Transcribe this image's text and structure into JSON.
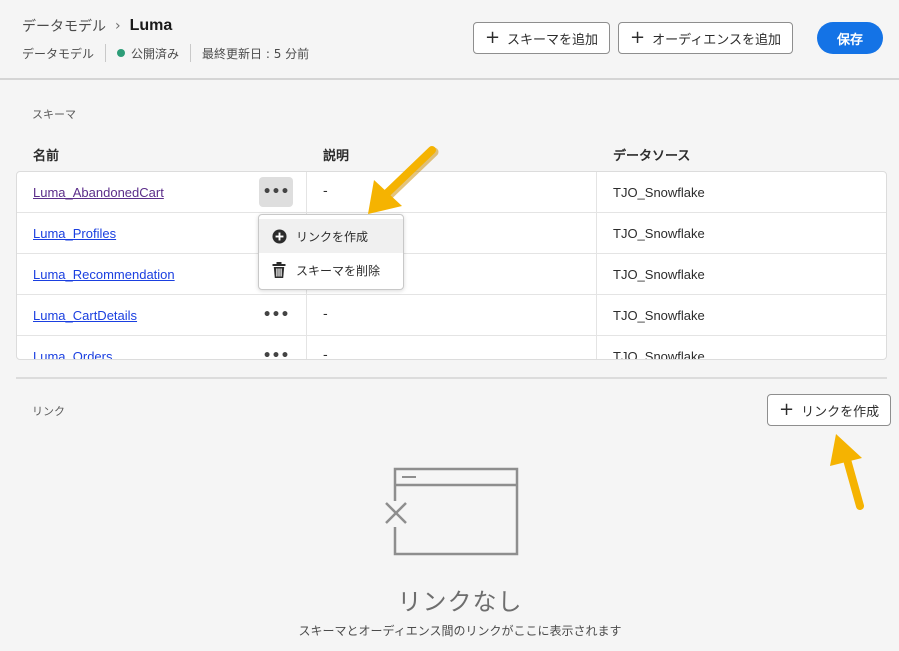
{
  "header": {
    "breadcrumb_parent": "データモデル",
    "breadcrumb_separator": "›",
    "breadcrumb_current": "Luma",
    "meta_type": "データモデル",
    "meta_status": "公開済み",
    "meta_status_color": "#2d9d78",
    "meta_updated": "最終更新日 : 5 分前",
    "add_schema_label": "スキーマを追加",
    "add_audience_label": "オーディエンスを追加",
    "save_label": "保存"
  },
  "schema": {
    "section_label": "スキーマ",
    "columns": [
      "名前",
      "説明",
      "データソース"
    ],
    "rows": [
      {
        "name": "Luma_AbandonedCart",
        "description": "-",
        "source": "TJO_Snowflake"
      },
      {
        "name": "Luma_Profiles",
        "description": "-",
        "source": "TJO_Snowflake"
      },
      {
        "name": "Luma_Recommendation",
        "description": "-",
        "source": "TJO_Snowflake"
      },
      {
        "name": "Luma_CartDetails",
        "description": "-",
        "source": "TJO_Snowflake"
      },
      {
        "name": "Luma_Orders",
        "description": "-",
        "source": "TJO_Snowflake"
      }
    ],
    "more_glyph": "•••"
  },
  "context_menu": {
    "items": [
      {
        "label": "リンクを作成",
        "icon": "add-circle-icon"
      },
      {
        "label": "スキーマを削除",
        "icon": "trash-icon"
      }
    ]
  },
  "links": {
    "section_label": "リンク",
    "create_link_label": "リンクを作成",
    "empty_title": "リンクなし",
    "empty_subtitle": "スキーマとオーディエンス間のリンクがここに表示されます"
  },
  "colors": {
    "accent": "#1473e6",
    "arrow": "#f5b301",
    "link": "#1a3fe0",
    "visited_link": "#5b2d8a"
  }
}
